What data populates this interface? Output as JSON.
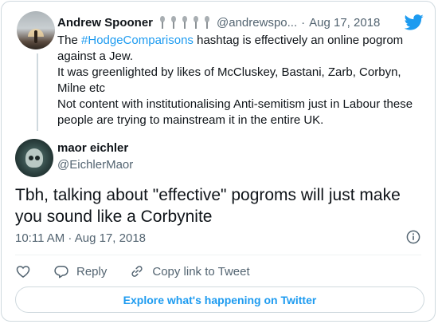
{
  "colors": {
    "accent": "#1d9bf0",
    "secondary_text": "#536471",
    "border": "#cfd9de"
  },
  "parent_tweet": {
    "author_name": "Andrew Spooner",
    "emoji": "pushpin",
    "handle": "@andrewspo...",
    "separator": "·",
    "date": "Aug 17, 2018",
    "hashtag": "#HodgeComparisons",
    "line1_pre": "The ",
    "line1_post": " hashtag is effectively an online pogrom",
    "line2": "against a Jew.",
    "line3": "It was greenlighted by likes of McCluskey, Bastani, Zarb, Corbyn,",
    "line4": "Milne etc",
    "line5": "Not content with institutionalising Anti-semitism just in Labour these",
    "line6": "people are trying to mainstream it in the entire UK.",
    "icon": "twitter-bird-icon"
  },
  "main_tweet": {
    "author_name": "maor eichler",
    "handle": "@EichlerMaor",
    "text": "Tbh, talking about \"effective\" pogroms will just make you sound like a Corbynite",
    "timestamp": "10:11 AM · Aug 17, 2018"
  },
  "actions": {
    "like_icon": "heart-icon",
    "reply_label": "Reply",
    "copy_link_label": "Copy link to Tweet"
  },
  "explore_label": "Explore what's happening on Twitter"
}
